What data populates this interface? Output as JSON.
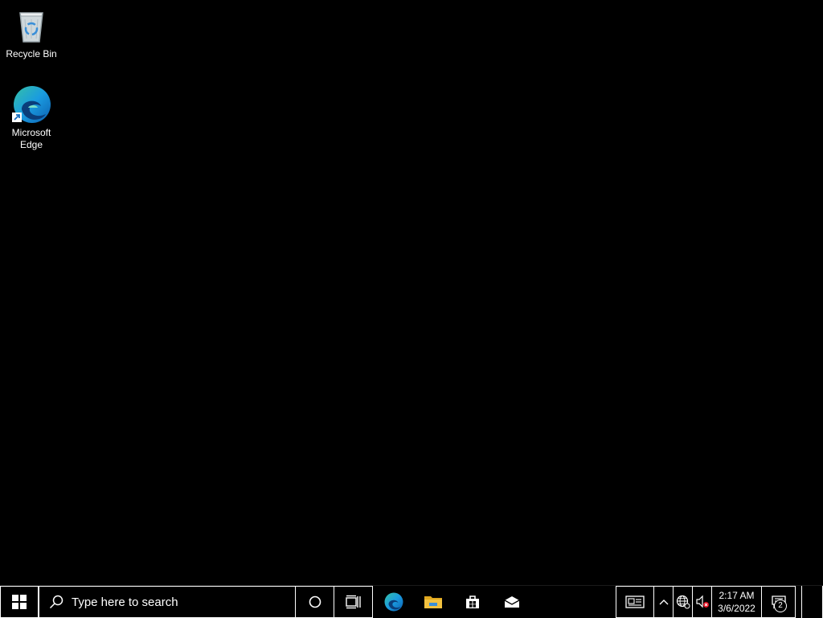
{
  "desktop": {
    "background_color": "#000000",
    "icons": [
      {
        "label": "Recycle Bin",
        "icon": "recycle-bin-icon"
      },
      {
        "label": "Microsoft Edge",
        "icon": "edge-icon",
        "shortcut": true
      }
    ]
  },
  "taskbar": {
    "search": {
      "placeholder": "Type here to search",
      "icon": "search-icon"
    },
    "buttons": [
      {
        "name": "start",
        "icon": "windows-logo-icon"
      },
      {
        "name": "cortana",
        "icon": "cortana-circle-icon"
      },
      {
        "name": "task-view",
        "icon": "task-view-icon"
      }
    ],
    "pinned_apps": [
      {
        "name": "Microsoft Edge",
        "icon": "edge-icon"
      },
      {
        "name": "File Explorer",
        "icon": "folder-icon"
      },
      {
        "name": "Microsoft Store",
        "icon": "store-bag-icon"
      },
      {
        "name": "Mail",
        "icon": "mail-icon"
      }
    ],
    "tray": {
      "news_icon": "news-widget-icon",
      "chevron_icon": "chevron-up-icon",
      "network_icon": "globe-network-icon",
      "volume_icon": "volume-muted-icon",
      "time": "2:17 AM",
      "date": "3/6/2022",
      "notification_count": "2",
      "notification_icon": "action-center-icon"
    }
  },
  "colors": {
    "edge_blue": "#0c78d4",
    "edge_green": "#35c1a6",
    "folder_yellow": "#f3c240",
    "mute_red": "#e81123"
  }
}
